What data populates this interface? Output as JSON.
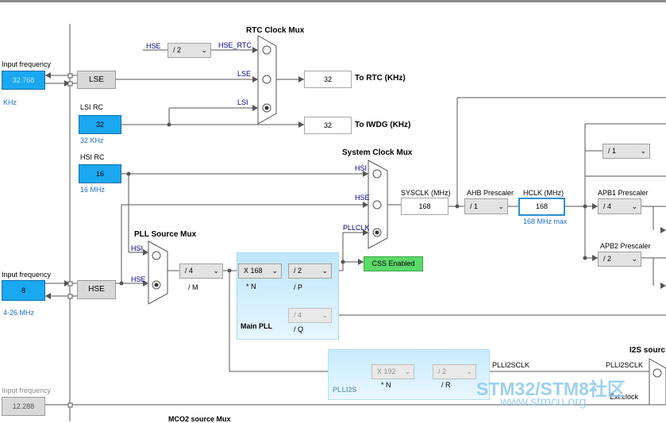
{
  "mux_titles": {
    "rtc": "RTC Clock Mux",
    "system": "System Clock Mux",
    "pll_source": "PLL Source Mux",
    "i2s": "I2S sourc",
    "mco2": "MCO2 source Mux"
  },
  "lse_input": {
    "label": "Input frequency",
    "value": "32.768",
    "unit": "KHz"
  },
  "hse_input": {
    "label": "Input frequency",
    "value": "8",
    "range": "4-26 MHz"
  },
  "ext_input": {
    "label": "Input frequency",
    "value": "12.288"
  },
  "lse_block": "LSE",
  "hse_block": "HSE",
  "lsi_rc": {
    "label": "LSI RC",
    "value": "32",
    "unit": "32 KHz"
  },
  "hsi_rc": {
    "label": "HSI RC",
    "value": "16",
    "unit": "16 MHz"
  },
  "rtc_mux": {
    "hse_label": "HSE",
    "hse_div": "/ 2",
    "hse_rtc": "HSE_RTC",
    "lse": "LSE",
    "lsi": "LSI"
  },
  "rtc_out": {
    "value": "32",
    "label": "To RTC (KHz)"
  },
  "iwdg_out": {
    "value": "32",
    "label": "To IWDG (KHz)"
  },
  "sys_mux": {
    "hsi": "HSI",
    "hse": "HSE",
    "pllclk": "PLLCLK"
  },
  "css_button": "CSS Enabled",
  "pll_src": {
    "hsi": "HSI",
    "hse": "HSE"
  },
  "pll_m": {
    "value": "/ 4",
    "label": "/ M"
  },
  "main_pll": {
    "title": "Main PLL",
    "n_value": "X 168",
    "n_label": "* N",
    "p_value": "/ 2",
    "p_label": "/ P",
    "q_value": "/ 4",
    "q_label": "/ Q"
  },
  "sysclk": {
    "label": "SYSCLK (MHz)",
    "value": "168"
  },
  "ahb": {
    "label": "AHB Prescaler",
    "value": "/ 1"
  },
  "hclk": {
    "label": "HCLK (MHz)",
    "value": "168",
    "max": "168 MHz max"
  },
  "apb1": {
    "label": "APB1 Prescaler",
    "value": "/ 4"
  },
  "apb2": {
    "label": "APB2 Prescaler",
    "value": "/ 2"
  },
  "top_div": {
    "value": "/ 1"
  },
  "plli2s": {
    "title": "PLLI2S",
    "n_value": "X 192",
    "n_label": "* N",
    "r_value": "/ 2",
    "r_label": "/ R",
    "clk_label": "PLLI2SCLK",
    "clk_label2": "PLLI2SCLK",
    "ext_clock": "Ext.clock"
  },
  "watermark": {
    "brand": "STM32/STM8社区",
    "url": "www.stmcu.org"
  },
  "colors": {
    "accent": "#1aa8f0",
    "css_green": "#5dd86b",
    "panel_blue": "#bfe6fb"
  }
}
